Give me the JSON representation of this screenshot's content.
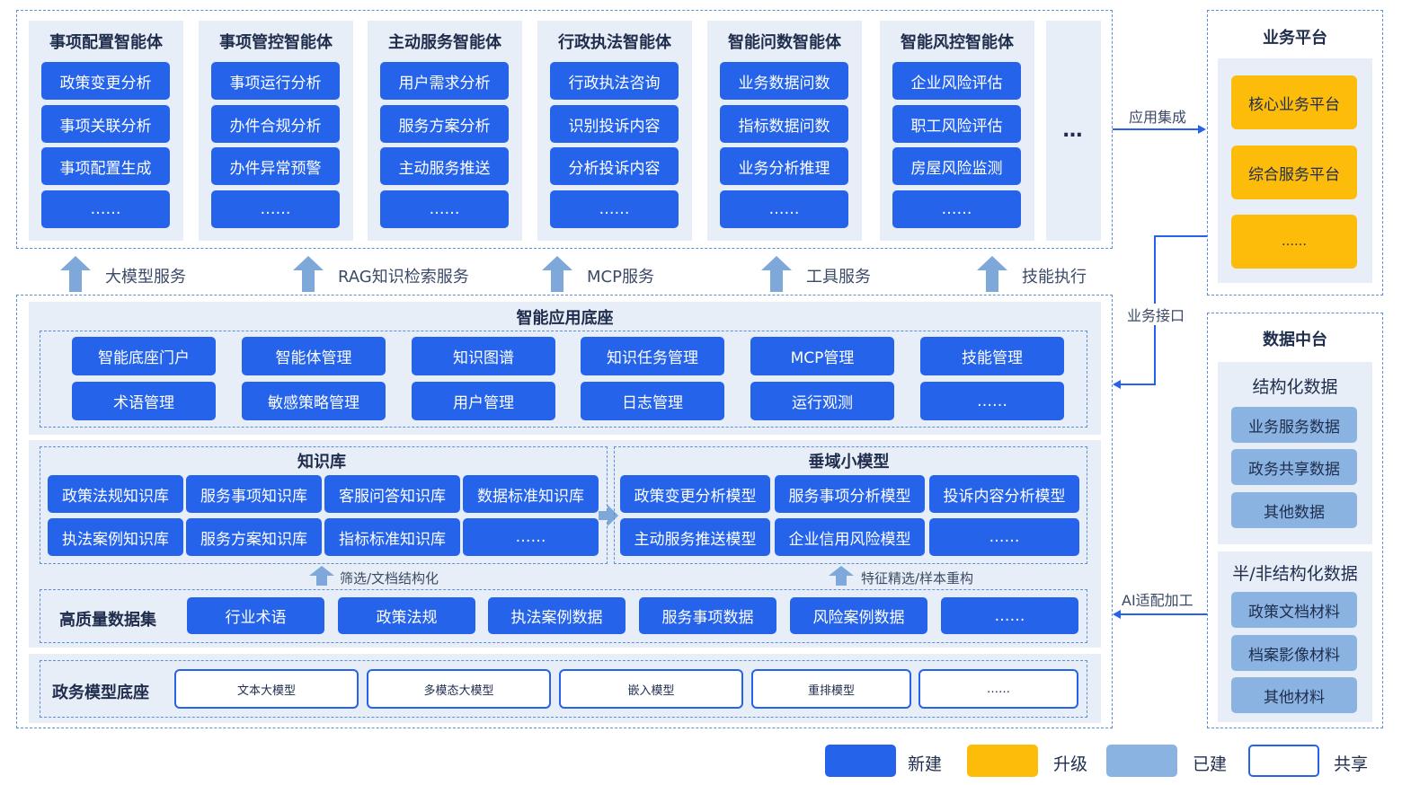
{
  "agents": [
    {
      "title": "事项配置智能体",
      "items": [
        "政策变更分析",
        "事项关联分析",
        "事项配置生成",
        "……"
      ]
    },
    {
      "title": "事项管控智能体",
      "items": [
        "事项运行分析",
        "办件合规分析",
        "办件异常预警",
        "……"
      ]
    },
    {
      "title": "主动服务智能体",
      "items": [
        "用户需求分析",
        "服务方案分析",
        "主动服务推送",
        "……"
      ]
    },
    {
      "title": "行政执法智能体",
      "items": [
        "行政执法咨询",
        "识别投诉内容",
        "分析投诉内容",
        "……"
      ]
    },
    {
      "title": "智能问数智能体",
      "items": [
        "业务数据问数",
        "指标数据问数",
        "业务分析推理",
        "……"
      ]
    },
    {
      "title": "智能风控智能体",
      "items": [
        "企业风险评估",
        "职工风险评估",
        "房屋风险监测",
        "……"
      ]
    }
  ],
  "agents_more": "…",
  "services": [
    "大模型服务",
    "RAG知识检索服务",
    "MCP服务",
    "工具服务",
    "技能执行"
  ],
  "base": {
    "title": "智能应用底座",
    "row1": [
      "智能底座门户",
      "智能体管理",
      "知识图谱",
      "知识任务管理",
      "MCP管理",
      "技能管理"
    ],
    "row2": [
      "术语管理",
      "敏感策略管理",
      "用户管理",
      "日志管理",
      "运行观测",
      "……"
    ]
  },
  "kb": {
    "title": "知识库",
    "row1": [
      "政策法规知识库",
      "服务事项知识库",
      "客服问答知识库",
      "数据标准知识库"
    ],
    "row2": [
      "执法案例知识库",
      "服务方案知识库",
      "指标标准知识库",
      "……"
    ],
    "note": "筛选/文档结构化"
  },
  "sm": {
    "title": "垂域小模型",
    "row1": [
      "政策变更分析模型",
      "服务事项分析模型",
      "投诉内容分析模型"
    ],
    "row2": [
      "主动服务推送模型",
      "企业信用风险模型",
      "……"
    ],
    "note": "特征精选/样本重构"
  },
  "dataset": {
    "title": "高质量数据集",
    "items": [
      "行业术语",
      "政策法规",
      "执法案例数据",
      "服务事项数据",
      "风险案例数据",
      "……"
    ]
  },
  "model_base": {
    "title": "政务模型底座",
    "items": [
      "文本大模型",
      "多模态大模型",
      "嵌入模型",
      "重排模型",
      "……"
    ]
  },
  "connectors": {
    "app_integration": "应用集成",
    "biz_interface": "业务接口",
    "ai_processing": "AI适配加工"
  },
  "biz_platform": {
    "title": "业务平台",
    "items": [
      "核心业务平台",
      "综合服务平台",
      "……"
    ]
  },
  "data_center": {
    "title": "数据中台",
    "structured": {
      "title": "结构化数据",
      "items": [
        "业务服务数据",
        "政务共享数据",
        "其他数据"
      ]
    },
    "unstructured": {
      "title": "半/非结构化数据",
      "items": [
        "政策文档材料",
        "档案影像材料",
        "其他材料"
      ]
    }
  },
  "legend": [
    {
      "label": "新建",
      "color": "#2563eb"
    },
    {
      "label": "升级",
      "color": "#fdbb0a"
    },
    {
      "label": "已建",
      "color": "#8ab3e2"
    },
    {
      "label": "共享",
      "color": "#ffffff"
    }
  ]
}
